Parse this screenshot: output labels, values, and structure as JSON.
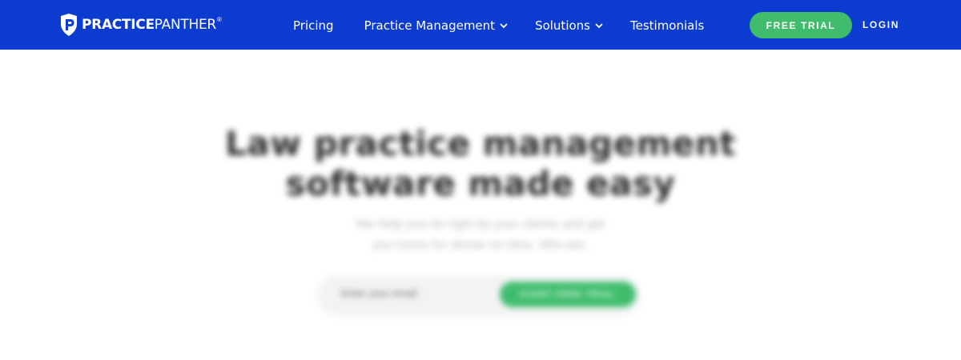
{
  "header": {
    "logo": {
      "text_bold": "PRACTICE",
      "text_light": "PANTHER",
      "trademark": "®"
    },
    "nav": [
      {
        "label": "Pricing",
        "has_dropdown": false
      },
      {
        "label": "Practice Management",
        "has_dropdown": true
      },
      {
        "label": "Solutions",
        "has_dropdown": true
      },
      {
        "label": "Testimonials",
        "has_dropdown": false
      }
    ],
    "cta_label": "FREE TRIAL",
    "login_label": "LOGIN"
  },
  "hero": {
    "title_line1": "Law practice management",
    "title_line2": "software made easy",
    "subtitle_line1": "We help you do right by your clients and get",
    "subtitle_line2": "you home for dinner on time. Win-win.",
    "email_placeholder": "Enter your email",
    "cta_label": "START FREE TRIAL"
  },
  "colors": {
    "nav_background": "#0b3bcf",
    "button_green": "#3fbd6c",
    "heading_text": "#2b2b2b",
    "subtitle_text": "#b9b9b9"
  },
  "icons": {
    "logo": "panther-shield-p-icon",
    "dropdown": "chevron-down-icon"
  }
}
